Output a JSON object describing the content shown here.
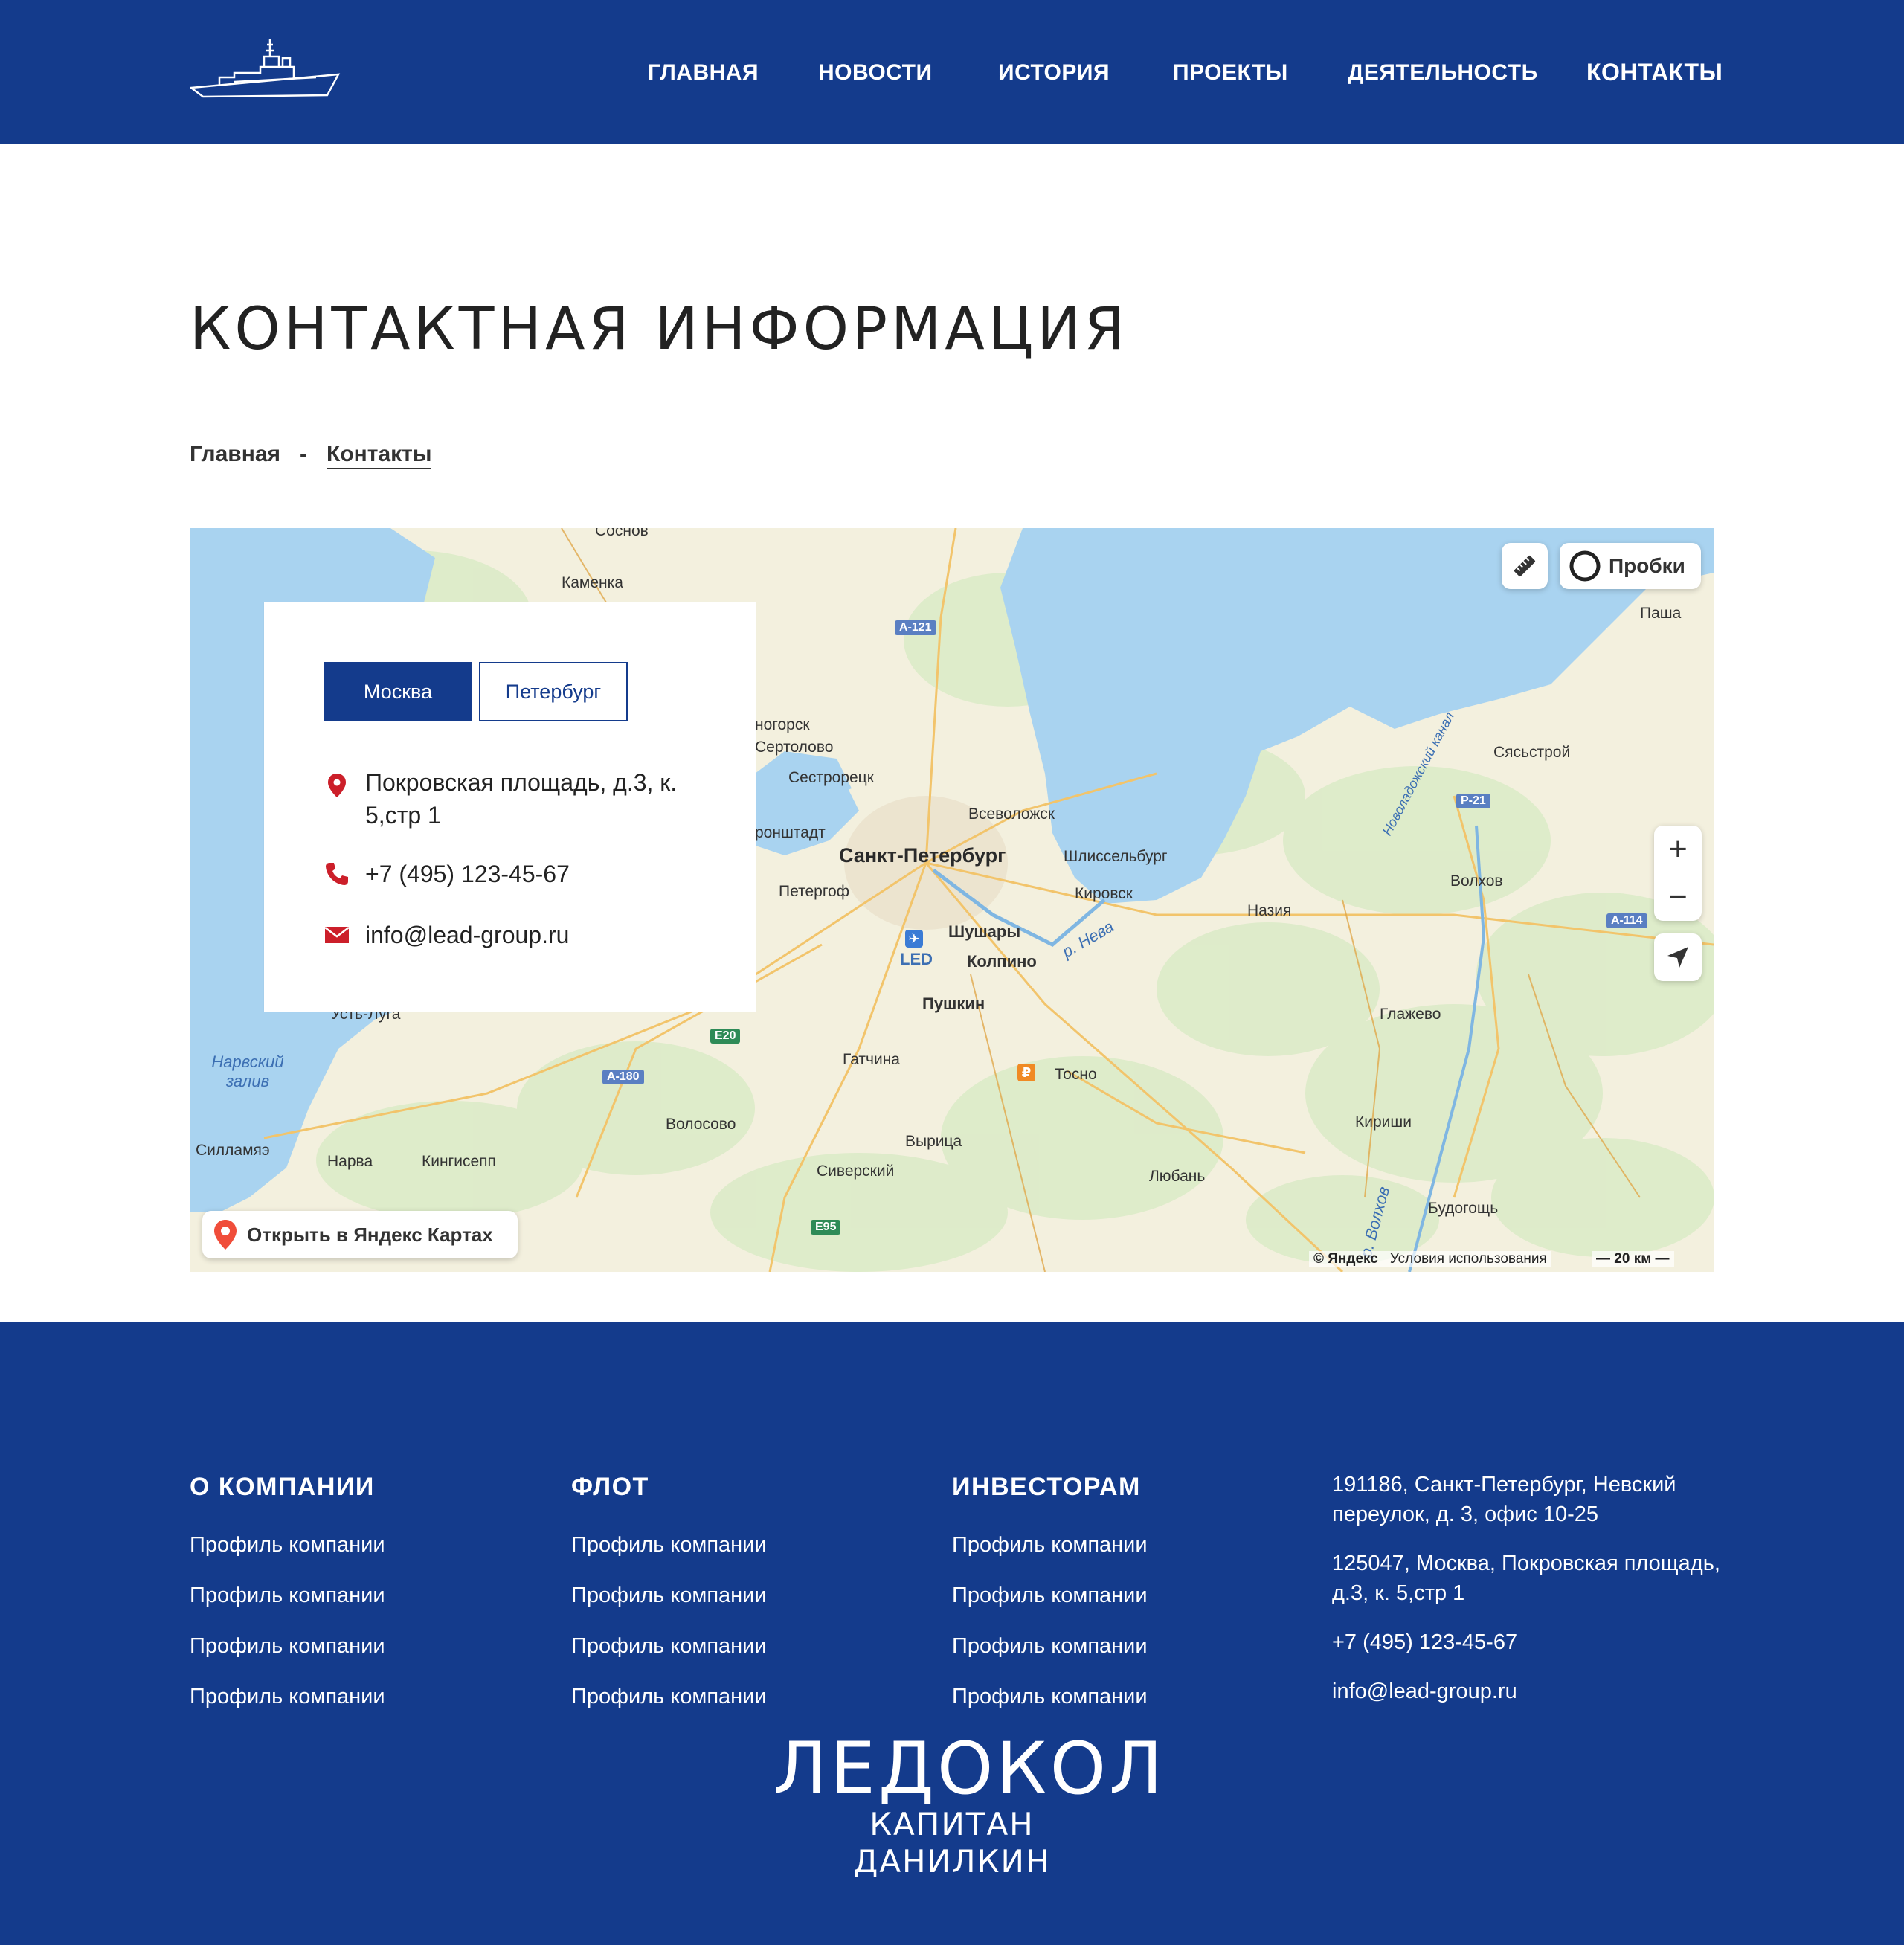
{
  "header": {
    "nav": [
      {
        "label": "ГЛАВНАЯ"
      },
      {
        "label": "НОВОСТИ"
      },
      {
        "label": "ИСТОРИЯ"
      },
      {
        "label": "ПРОЕКТЫ"
      },
      {
        "label": "ДЕЯТЕЛЬНОСТЬ"
      },
      {
        "label": "КОНТАКТЫ"
      }
    ]
  },
  "page": {
    "title": "КОНТАКТНАЯ ИНФОРМАЦИЯ",
    "breadcrumb": {
      "home": "Главная",
      "separator": "-",
      "current": "Контакты"
    }
  },
  "contact_card": {
    "tabs": [
      {
        "label": "Москва"
      },
      {
        "label": "Петербург"
      }
    ],
    "active_tab": "Москва",
    "address": "Покровская площадь, д.3, к. 5,стр 1",
    "phone": "+7 (495) 123-45-67",
    "email": "info@lead-group.ru"
  },
  "map": {
    "traffic_label": "Пробки",
    "open_label": "Открыть в Яндекс Картах",
    "copyright": "© Яндекс",
    "terms": "Условия использования",
    "scale": "20 км",
    "zoom_in": "+",
    "zoom_out": "−",
    "labels": {
      "kamenka": "Каменка",
      "pasha": "Паша",
      "sertolovo": "Сертолово",
      "sestroretsk": "Сестрорецк",
      "vsevolozhsk": "Всеволожск",
      "spb": "Санкт-Петербург",
      "shlisselburg": "Шлиссельбург",
      "peterhof": "Петергоф",
      "kirovsk": "Кировск",
      "nazia": "Назия",
      "volkhov": "Волхов",
      "syasstroy": "Сясьстрой",
      "shushary": "Шушары",
      "kolpino": "Колпино",
      "pushkin": "Пушкин",
      "led": "LED",
      "neva": "р. Нева",
      "glazhevo": "Глажево",
      "gatchina": "Гатчина",
      "tosno": "Тосно",
      "narva_bay": "Нарвский залив",
      "volosovo": "Волосово",
      "kirishi": "Кириши",
      "siverskiy": "Сиверский",
      "vyritsa": "Вырица",
      "lyuban": "Любань",
      "sillamae": "Силламяэ",
      "narva": "Нарва",
      "kingisepp": "Кингисепп",
      "budogoshch": "Будогощь",
      "volkhov_river": "р. Волхов",
      "ust_luga": "Усть-Луга",
      "kronstadt": "ронштадт",
      "zelenogorsk": "ногорск",
      "canal": "Новоладожский канал",
      "top": "Соснов"
    },
    "roads": {
      "a121": "А-121",
      "r21": "Р-21",
      "a114": "А-114",
      "e20": "E20",
      "a180": "А-180",
      "e95": "E95"
    }
  },
  "footer": {
    "columns": [
      {
        "title": "О КОМПАНИИ",
        "links": [
          "Профиль компании",
          "Профиль компании",
          "Профиль компании",
          "Профиль компании"
        ]
      },
      {
        "title": "ФЛОТ",
        "links": [
          "Профиль компании",
          "Профиль компании",
          "Профиль компании",
          "Профиль компании"
        ]
      },
      {
        "title": "ИНВЕСТОРАМ",
        "links": [
          "Профиль компании",
          "Профиль компании",
          "Профиль компании",
          "Профиль компании"
        ]
      }
    ],
    "contacts": {
      "spb_address": "191186, Санкт-Петербург, Невский переулок, д. 3, офис 10-25",
      "msk_address": "125047, Москва, Покровская площадь, д.3, к. 5,стр 1",
      "phone": "+7 (495) 123-45-67",
      "email": "info@lead-group.ru"
    },
    "brand": {
      "name": "ЛЕДОКОЛ",
      "subtitle": "КАПИТАН ДАНИЛКИН"
    }
  },
  "colors": {
    "brand_blue": "#143b8c",
    "accent_red": "#cc1f2a",
    "water": "#a9d3f0"
  }
}
